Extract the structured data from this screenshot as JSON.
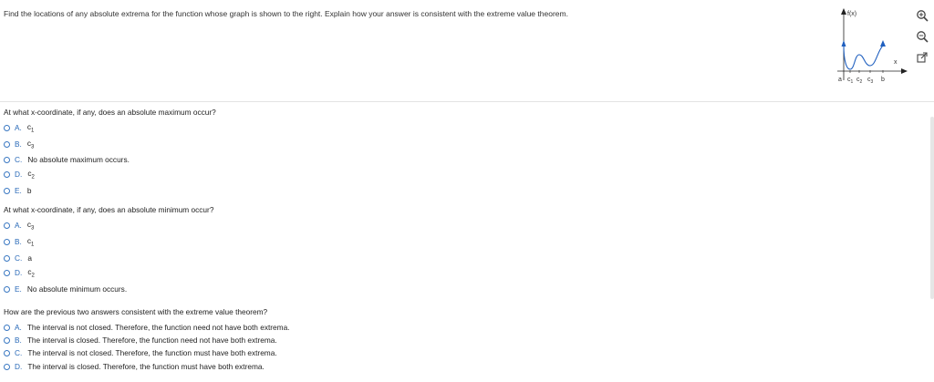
{
  "prompt": "Find the locations of any absolute extrema for the function whose graph is shown to the right. Explain how your answer is consistent with the extreme value theorem.",
  "graph": {
    "y_label": "f(x)",
    "x_label": "x",
    "a_label": "a",
    "b_label": "b",
    "c_labels": [
      {
        "base": "c",
        "sub": "1"
      },
      {
        "base": "c",
        "sub": "2"
      },
      {
        "base": "c",
        "sub": "3"
      }
    ]
  },
  "tools": [
    "zoom-in-icon",
    "zoom-out-icon",
    "popout-icon"
  ],
  "q1": {
    "text": "At what x-coordinate, if any, does an absolute maximum occur?",
    "options": [
      {
        "letter": "A.",
        "base": "c",
        "sub": "1",
        "tail": ""
      },
      {
        "letter": "B.",
        "base": "c",
        "sub": "3",
        "tail": ""
      },
      {
        "letter": "C.",
        "base": "No absolute maximum occurs.",
        "sub": "",
        "tail": ""
      },
      {
        "letter": "D.",
        "base": "c",
        "sub": "2",
        "tail": ""
      },
      {
        "letter": "E.",
        "base": "b",
        "sub": "",
        "tail": ""
      }
    ]
  },
  "q2": {
    "text": "At what x-coordinate, if any, does an absolute minimum occur?",
    "options": [
      {
        "letter": "A.",
        "base": "c",
        "sub": "3",
        "tail": ""
      },
      {
        "letter": "B.",
        "base": "c",
        "sub": "1",
        "tail": ""
      },
      {
        "letter": "C.",
        "base": "a",
        "sub": "",
        "tail": ""
      },
      {
        "letter": "D.",
        "base": "c",
        "sub": "2",
        "tail": ""
      },
      {
        "letter": "E.",
        "base": "No absolute minimum occurs.",
        "sub": "",
        "tail": ""
      }
    ]
  },
  "q3": {
    "text": "How are the previous two answers consistent with the extreme value theorem?",
    "options": [
      {
        "letter": "A.",
        "base": "The interval is not closed. Therefore, the function need not have both extrema.",
        "sub": "",
        "tail": ""
      },
      {
        "letter": "B.",
        "base": "The interval is closed. Therefore, the function need not have both extrema.",
        "sub": "",
        "tail": ""
      },
      {
        "letter": "C.",
        "base": "The interval is not closed. Therefore, the function must have both extrema.",
        "sub": "",
        "tail": ""
      },
      {
        "letter": "D.",
        "base": "The interval is closed. Therefore, the function must have both extrema.",
        "sub": "",
        "tail": ""
      }
    ]
  }
}
